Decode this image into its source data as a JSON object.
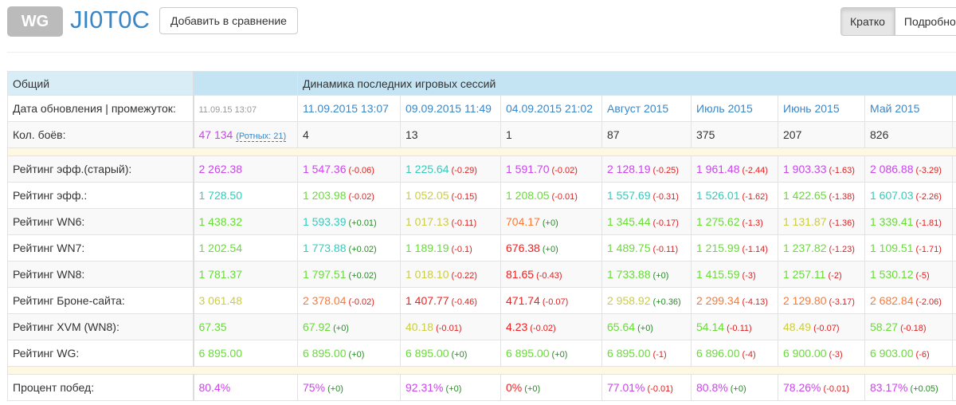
{
  "header": {
    "badge": "WG",
    "nickname": "JI0T0C",
    "compare_button": "Добавить в сравнение",
    "view_short": "Кратко",
    "view_detailed": "Подробно"
  },
  "colors": {
    "purple": "#cc44ee",
    "cyan": "#33ccbb",
    "green": "#66dd33",
    "yellow": "#cccc44",
    "orange": "#ff7733",
    "red": "#ee2020"
  },
  "table": {
    "overall_header": "Общий",
    "dynamics_header": "Динамика последних игровых сессий",
    "date_label": "Дата обновления | промежуток:",
    "overall_date": "11.09.15 13:07",
    "periods": [
      "11.09.2015 13:07",
      "09.09.2015 11:49",
      "04.09.2015 21:02",
      "Август 2015",
      "Июль 2015",
      "Июнь 2015",
      "Май 2015"
    ],
    "battles_label": "Кол. боёв:",
    "battles_total": "47 134",
    "company_battles": "(Ротных: 21)",
    "battles": [
      "4",
      "13",
      "1",
      "87",
      "375",
      "207",
      "826"
    ],
    "ratings": [
      {
        "label": "Рейтинг эфф.(старый):",
        "overall": {
          "v": "2 262.38",
          "c": "purple"
        },
        "cells": [
          [
            "1 547.36",
            "-0.06",
            "purple"
          ],
          [
            "1 225.64",
            "-0.29",
            "cyan"
          ],
          [
            "1 591.70",
            "-0.02",
            "purple"
          ],
          [
            "2 128.19",
            "-0.25",
            "purple"
          ],
          [
            "1 961.48",
            "-2.44",
            "purple"
          ],
          [
            "1 903.33",
            "-1.63",
            "purple"
          ],
          [
            "2 086.88",
            "-3.29",
            "purple"
          ]
        ]
      },
      {
        "label": "Рейтинг эфф.:",
        "overall": {
          "v": "1 728.50",
          "c": "cyan"
        },
        "cells": [
          [
            "1 203.98",
            "-0.02",
            "green"
          ],
          [
            "1 052.05",
            "-0.15",
            "yellow"
          ],
          [
            "1 208.05",
            "-0.01",
            "green"
          ],
          [
            "1 557.69",
            "-0.31",
            "cyan"
          ],
          [
            "1 526.01",
            "-1.62",
            "cyan"
          ],
          [
            "1 422.65",
            "-1.38",
            "green"
          ],
          [
            "1 607.03",
            "-2.26",
            "cyan"
          ]
        ]
      },
      {
        "label": "Рейтинг WN6:",
        "overall": {
          "v": "1 438.32",
          "c": "green"
        },
        "cells": [
          [
            "1 593.39",
            "+0.01",
            "cyan"
          ],
          [
            "1 017.13",
            "-0.11",
            "yellow"
          ],
          [
            "704.17",
            "+0",
            "orange"
          ],
          [
            "1 345.44",
            "-0.17",
            "green"
          ],
          [
            "1 275.62",
            "-1.3",
            "green"
          ],
          [
            "1 131.87",
            "-1.36",
            "yellow"
          ],
          [
            "1 339.41",
            "-1.81",
            "green"
          ]
        ]
      },
      {
        "label": "Рейтинг WN7:",
        "overall": {
          "v": "1 202.54",
          "c": "green"
        },
        "cells": [
          [
            "1 773.88",
            "+0.02",
            "cyan"
          ],
          [
            "1 189.19",
            "-0.1",
            "green"
          ],
          [
            "676.38",
            "+0",
            "red"
          ],
          [
            "1 489.75",
            "-0.11",
            "green"
          ],
          [
            "1 215.99",
            "-1.14",
            "green"
          ],
          [
            "1 237.82",
            "-1.23",
            "green"
          ],
          [
            "1 109.51",
            "-1.71",
            "green"
          ]
        ]
      },
      {
        "label": "Рейтинг WN8:",
        "overall": {
          "v": "1 781.37",
          "c": "green"
        },
        "cells": [
          [
            "1 797.51",
            "+0.02",
            "green"
          ],
          [
            "1 018.10",
            "-0.22",
            "yellow"
          ],
          [
            "81.65",
            "-0.43",
            "red"
          ],
          [
            "1 733.88",
            "+0",
            "green"
          ],
          [
            "1 415.59",
            "-3",
            "green"
          ],
          [
            "1 257.11",
            "-2",
            "green"
          ],
          [
            "1 530.12",
            "-5",
            "green"
          ]
        ]
      },
      {
        "label": "Рейтинг Броне-сайта:",
        "overall": {
          "v": "3 061.48",
          "c": "yellow"
        },
        "cells": [
          [
            "2 378.04",
            "-0.02",
            "orange"
          ],
          [
            "1 407.77",
            "-0.46",
            "red"
          ],
          [
            "471.74",
            "-0.07",
            "red"
          ],
          [
            "2 958.92",
            "+0.36",
            "yellow"
          ],
          [
            "2 299.34",
            "-4.13",
            "orange"
          ],
          [
            "2 129.80",
            "-3.17",
            "orange"
          ],
          [
            "2 682.84",
            "-2.06",
            "orange"
          ]
        ]
      },
      {
        "label": "Рейтинг XVM (WN8):",
        "overall": {
          "v": "67.35",
          "c": "green"
        },
        "cells": [
          [
            "67.92",
            "+0",
            "green"
          ],
          [
            "40.18",
            "-0.01",
            "yellow"
          ],
          [
            "4.23",
            "-0.02",
            "red"
          ],
          [
            "65.64",
            "+0",
            "green"
          ],
          [
            "54.14",
            "-0.11",
            "green"
          ],
          [
            "48.49",
            "-0.07",
            "yellow"
          ],
          [
            "58.27",
            "-0.18",
            "green"
          ]
        ]
      },
      {
        "label": "Рейтинг WG:",
        "overall": {
          "v": "6 895.00",
          "c": "green"
        },
        "cells": [
          [
            "6 895.00",
            "+0",
            "green"
          ],
          [
            "6 895.00",
            "+0",
            "green"
          ],
          [
            "6 895.00",
            "+0",
            "green"
          ],
          [
            "6 895.00",
            "-1",
            "green"
          ],
          [
            "6 896.00",
            "-4",
            "green"
          ],
          [
            "6 900.00",
            "-3",
            "green"
          ],
          [
            "6 903.00",
            "-6",
            "green"
          ]
        ]
      }
    ],
    "winrate": {
      "label": "Процент побед:",
      "overall": {
        "v": "80.4%",
        "c": "purple"
      },
      "cells": [
        [
          "75%",
          "+0",
          "purple"
        ],
        [
          "92.31%",
          "+0",
          "purple"
        ],
        [
          "0%",
          "+0",
          "red"
        ],
        [
          "77.01%",
          "-0.01",
          "purple"
        ],
        [
          "80.8%",
          "+0",
          "purple"
        ],
        [
          "78.26%",
          "-0.01",
          "purple"
        ],
        [
          "83.17%",
          "+0.05",
          "purple"
        ]
      ]
    }
  }
}
